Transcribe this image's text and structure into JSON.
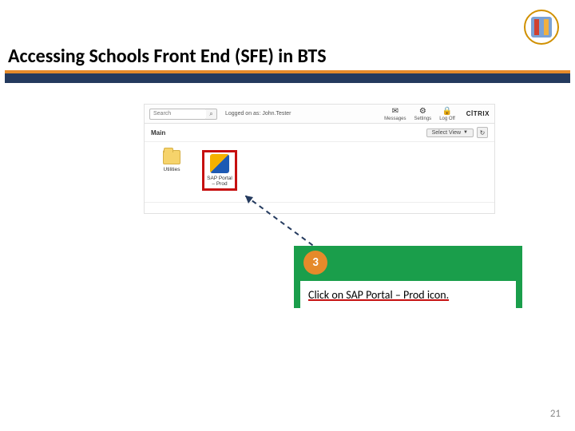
{
  "slide": {
    "title": "Accessing Schools Front End (SFE) in BTS",
    "page_number": "21"
  },
  "callout": {
    "step_number": "3",
    "instruction": "Click on SAP Portal – Prod icon."
  },
  "citrix": {
    "search_placeholder": "Search",
    "logged_text": "Logged on as: John.Tester",
    "brand": "CİTRIX",
    "topbar": {
      "messages": "Messages",
      "settings": "Settings",
      "logoff": "Log Off"
    },
    "main_label": "Main",
    "select_view": "Select View",
    "apps": {
      "utilities": "Utilities",
      "sap_portal": "SAP Portal – Prod"
    }
  },
  "icons": {
    "search": "search-icon",
    "messages": "envelope-icon",
    "settings": "gear-icon",
    "logoff": "lock-icon",
    "chevron": "chevron-down-icon",
    "refresh": "refresh-icon",
    "folder": "folder-icon",
    "sap": "sap-shield-icon"
  }
}
